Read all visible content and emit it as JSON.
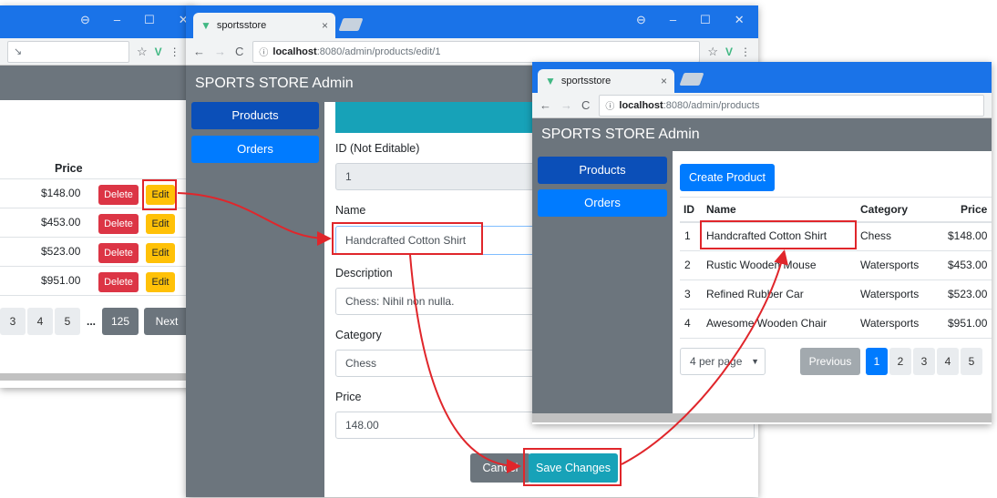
{
  "colors": {
    "chrome_blue": "#1a73e8",
    "app_gray": "#6c757d",
    "primary": "#007bff",
    "teal": "#17a2b8",
    "danger": "#dc3545",
    "warning": "#ffc107",
    "highlight": "#e0262b"
  },
  "left_window": {
    "column_header": "Price",
    "rows": [
      {
        "price": "$148.00",
        "delete_label": "Delete",
        "edit_label": "Edit"
      },
      {
        "price": "$453.00",
        "delete_label": "Delete",
        "edit_label": "Edit"
      },
      {
        "price": "$523.00",
        "delete_label": "Delete",
        "edit_label": "Edit"
      },
      {
        "price": "$951.00",
        "delete_label": "Delete",
        "edit_label": "Edit"
      }
    ],
    "pagination": [
      "3",
      "4",
      "5",
      "...",
      "125",
      "Next"
    ]
  },
  "edit_window": {
    "tab_title": "sportsstore",
    "url_host": "localhost",
    "url_path": ":8080/admin/products/edit/1",
    "app_title": "SPORTS STORE Admin",
    "nav": [
      "Products",
      "Orders"
    ],
    "form": {
      "id_label": "ID (Not Editable)",
      "id_value": "1",
      "name_label": "Name",
      "name_value": "Handcrafted Cotton Shirt",
      "description_label": "Description",
      "description_value": "Chess: Nihil non nulla.",
      "category_label": "Category",
      "category_value": "Chess",
      "price_label": "Price",
      "price_value": "148.00"
    },
    "cancel_label": "Cancel",
    "save_label": "Save Changes"
  },
  "list_window": {
    "tab_title": "sportsstore",
    "url_host": "localhost",
    "url_path": ":8080/admin/products",
    "app_title": "SPORTS STORE Admin",
    "nav": [
      "Products",
      "Orders"
    ],
    "create_label": "Create Product",
    "headers": [
      "ID",
      "Name",
      "Category",
      "Price"
    ],
    "rows": [
      {
        "id": "1",
        "name": "Handcrafted Cotton Shirt",
        "category": "Chess",
        "price": "$148.00"
      },
      {
        "id": "2",
        "name": "Rustic Wooden Mouse",
        "category": "Watersports",
        "price": "$453.00"
      },
      {
        "id": "3",
        "name": "Refined Rubber Car",
        "category": "Watersports",
        "price": "$523.00"
      },
      {
        "id": "4",
        "name": "Awesome Wooden Chair",
        "category": "Watersports",
        "price": "$951.00"
      }
    ],
    "per_page": "4 per page",
    "previous_label": "Previous",
    "pages": [
      "1",
      "2",
      "3",
      "4",
      "5"
    ]
  }
}
